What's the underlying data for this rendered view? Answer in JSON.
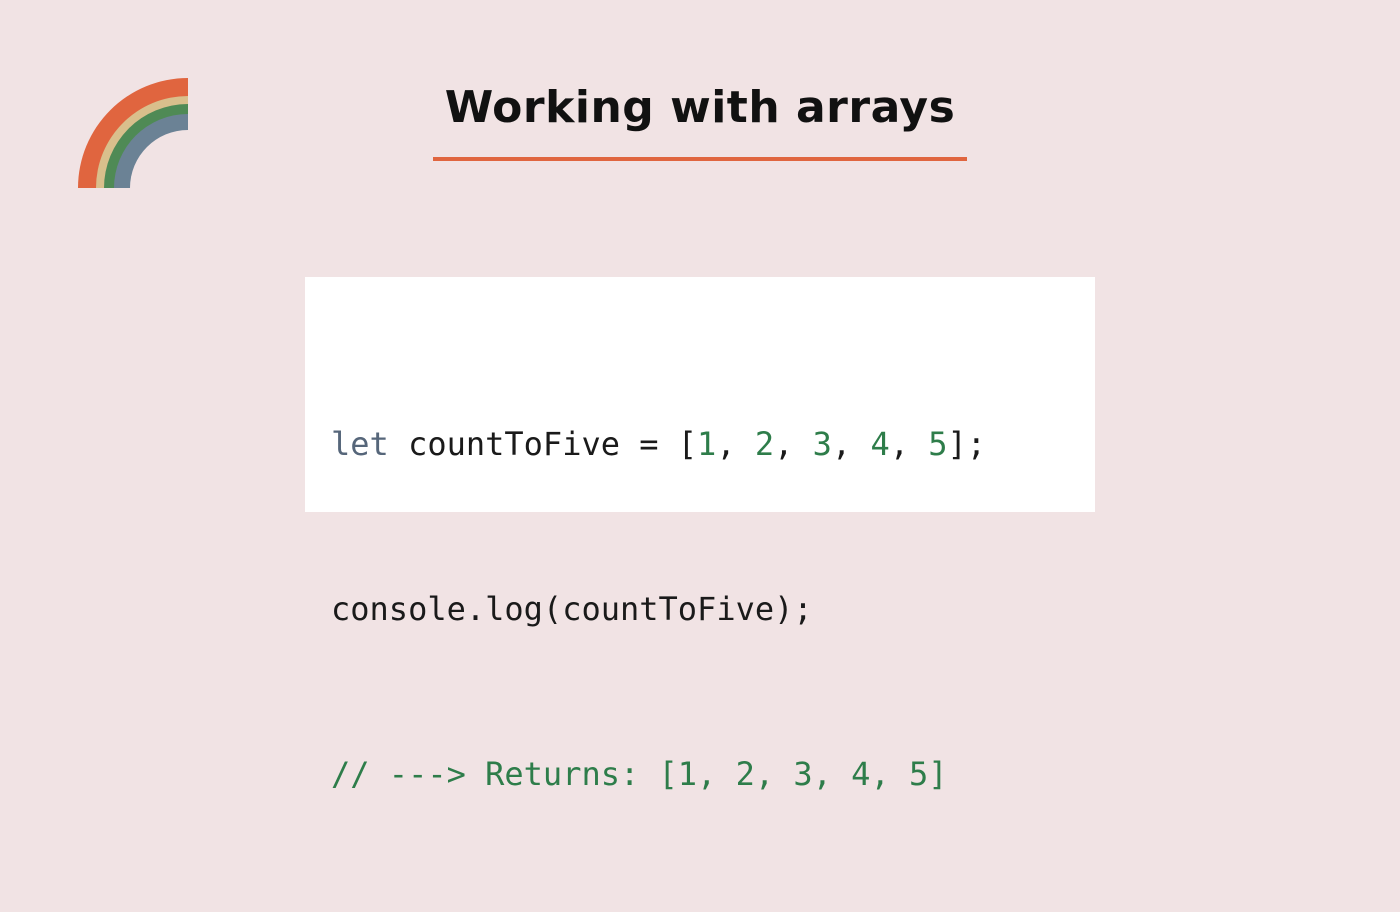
{
  "slide": {
    "title": "Working with arrays",
    "accent_color": "#e0653f",
    "background_color": "#f1e3e4"
  },
  "logo": {
    "icon": "rainbow-arc-icon",
    "colors": [
      "#e0653f",
      "#d9bf8c",
      "#4f8a55",
      "#6b8295"
    ]
  },
  "code": {
    "line1": {
      "keyword": "let",
      "decl": " countToFive = [",
      "n1": "1",
      "sep1": ", ",
      "n2": "2",
      "sep2": ", ",
      "n3": "3",
      "sep3": ", ",
      "n4": "4",
      "sep4": ", ",
      "n5": "5",
      "end": "];"
    },
    "line2": "console.log(countToFive);",
    "line3": "// ---> Returns: [1, 2, 3, 4, 5]"
  }
}
